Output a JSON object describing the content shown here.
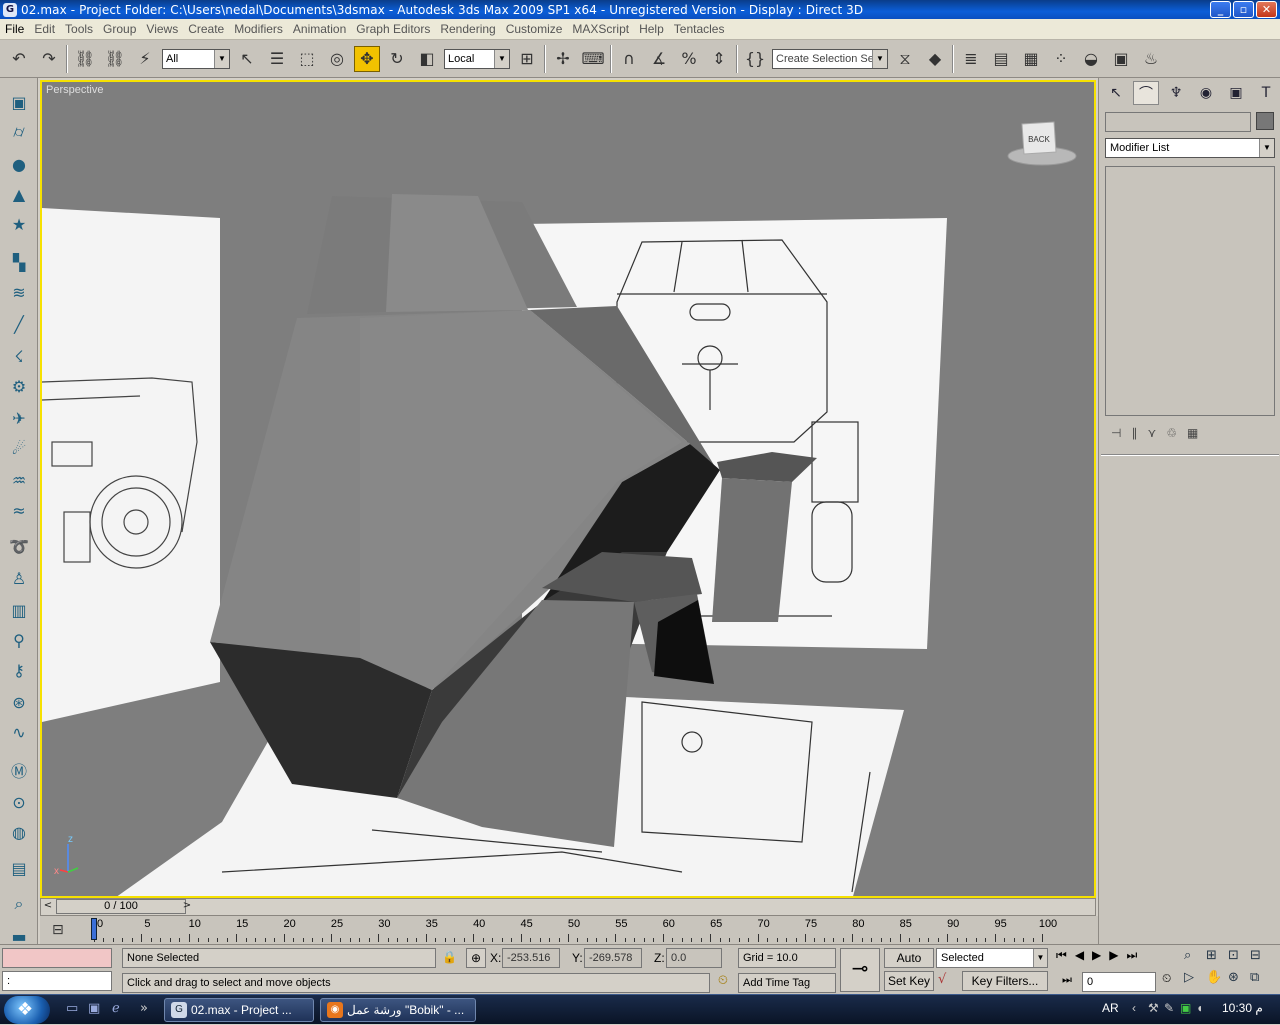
{
  "titlebar": {
    "title": "02.max     - Project Folder: C:\\Users\\nedal\\Documents\\3dsmax      - Autodesk 3ds Max  2009 SP1  x64   - Unregistered Version     - Display : Direct 3D",
    "app_icon": "3ds-max-icon",
    "controls": [
      "_",
      "▫",
      "✕"
    ]
  },
  "menubar": {
    "items": [
      "File",
      "Edit",
      "Tools",
      "Group",
      "Views",
      "Create",
      "Modifiers",
      "Animation",
      "Graph Editors",
      "Rendering",
      "Customize",
      "MAXScript",
      "Help",
      "Tentacles"
    ]
  },
  "toolbar": {
    "selection_filter": "All",
    "reference_coord": "Local",
    "named_selection_placeholder": "Create Selection Set",
    "active_tool": "select-and-move"
  },
  "viewport": {
    "label": "Perspective",
    "viewcube_label": "BACK",
    "axis_z": "z",
    "axis_x": "x",
    "border_color": "#f6e100",
    "background_color": "#7e7e7e"
  },
  "command_panel": {
    "modifier_list_label": "Modifier List"
  },
  "time_slider": {
    "label": "0 / 100",
    "ticks": [
      "0",
      "5",
      "10",
      "15",
      "20",
      "25",
      "30",
      "35",
      "40",
      "45",
      "50",
      "55",
      "60",
      "65",
      "70",
      "75",
      "80",
      "85",
      "90",
      "95",
      "100"
    ]
  },
  "status": {
    "maxscript_prompt": ":",
    "selection_info": "None Selected",
    "prompt": "Click and drag to select and move objects",
    "x_label": "X:",
    "x_value": "-253.516",
    "y_label": "Y:",
    "y_value": "-269.578",
    "z_label": "Z:",
    "z_value": "0.0",
    "grid": "Grid = 10.0",
    "add_time_tag": "Add Time Tag",
    "auto_key": "Auto Key",
    "set_key": "Set Key",
    "key_mode": "Selected",
    "key_filters": "Key Filters...",
    "current_frame": "0"
  },
  "taskbar": {
    "tasks": [
      {
        "label": "02.max    - Project ...",
        "icon": "3ds-max-icon"
      },
      {
        "label": "ورشة عمل \"Bobik\" - ...",
        "icon": "firefox-icon"
      }
    ],
    "language": "AR",
    "clock": "10:30 م"
  }
}
